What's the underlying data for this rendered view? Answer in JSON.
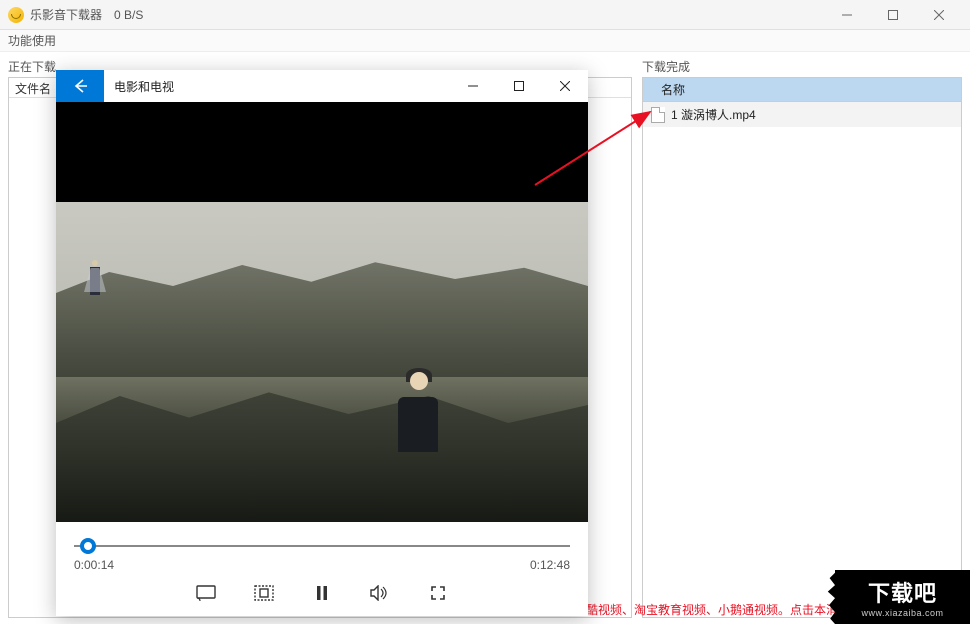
{
  "titlebar": {
    "title": "乐影音下载器",
    "speed": "0 B/S"
  },
  "menubar": {
    "item1": "功能使用"
  },
  "left_panel": {
    "label": "正在下载",
    "header": "文件名"
  },
  "right_panel": {
    "label": "下载完成",
    "header": "名称",
    "files": [
      {
        "name": "1 漩涡博人.mp4"
      }
    ]
  },
  "player": {
    "title": "电影和电视",
    "current_time": "0:00:14",
    "duration": "0:12:48"
  },
  "bottom_link": "优酷视频、淘宝教育视频、小鹅通视频。点击本消息",
  "watermark": {
    "main": "下载吧",
    "sub": "www.xiazaiba.com"
  }
}
